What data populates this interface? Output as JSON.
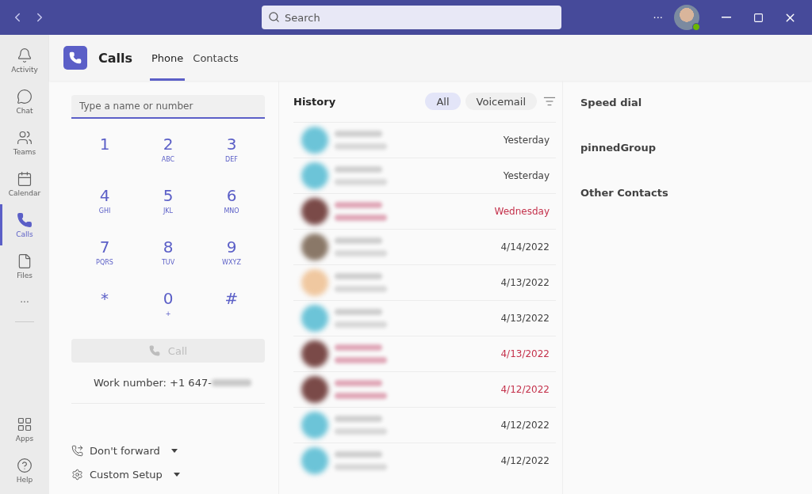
{
  "titlebar": {
    "search_placeholder": "Search",
    "more": "···"
  },
  "sidebar": {
    "items": [
      {
        "label": "Activity",
        "selected": false
      },
      {
        "label": "Chat",
        "selected": false
      },
      {
        "label": "Teams",
        "selected": false
      },
      {
        "label": "Calendar",
        "selected": false
      },
      {
        "label": "Calls",
        "selected": true
      },
      {
        "label": "Files",
        "selected": false
      }
    ],
    "more": "···",
    "bottom": [
      {
        "label": "Apps",
        "selected": false
      },
      {
        "label": "Help",
        "selected": false
      }
    ]
  },
  "header": {
    "title": "Calls",
    "tabs": [
      {
        "label": "Phone",
        "selected": true
      },
      {
        "label": "Contacts",
        "selected": false
      }
    ]
  },
  "dialer": {
    "placeholder": "Type a name or number",
    "keys": [
      {
        "digit": "1"
      },
      {
        "digit": "2",
        "letters": "ABC"
      },
      {
        "digit": "3",
        "letters": "DEF"
      },
      {
        "digit": "4",
        "letters": "GHI"
      },
      {
        "digit": "5",
        "letters": "JKL"
      },
      {
        "digit": "6",
        "letters": "MNO"
      },
      {
        "digit": "7",
        "letters": "PQRS"
      },
      {
        "digit": "8",
        "letters": "TUV"
      },
      {
        "digit": "9",
        "letters": "WXYZ"
      },
      {
        "digit": "*"
      },
      {
        "digit": "0",
        "letters": "+"
      },
      {
        "digit": "#"
      }
    ],
    "call_button": {
      "label": "Call",
      "disabled": true
    },
    "work_number": "Work number: +1 647-",
    "options": [
      {
        "kind": "forward",
        "label": "Don't forward"
      },
      {
        "kind": "setup",
        "label": "Custom Setup"
      }
    ]
  },
  "history": {
    "title": "History",
    "filters": [
      {
        "label": "All",
        "selected": true
      },
      {
        "label": "Voicemail",
        "selected": false
      }
    ],
    "rows": [
      {
        "time": "Yesterday",
        "missed": false,
        "color": "#6cc4d8"
      },
      {
        "time": "Yesterday",
        "missed": false,
        "color": "#6cc4d8"
      },
      {
        "time": "Wednesday",
        "missed": true,
        "color": "#7a4a48"
      },
      {
        "time": "4/14/2022",
        "missed": false,
        "color": "#8a7868"
      },
      {
        "time": "4/13/2022",
        "missed": false,
        "color": "#f0c8a0"
      },
      {
        "time": "4/13/2022",
        "missed": false,
        "color": "#6cc4d8"
      },
      {
        "time": "4/13/2022",
        "missed": true,
        "color": "#7a4a48"
      },
      {
        "time": "4/12/2022",
        "missed": true,
        "color": "#7a4a48"
      },
      {
        "time": "4/12/2022",
        "missed": false,
        "color": "#6cc4d8"
      },
      {
        "time": "4/12/2022",
        "missed": false,
        "color": "#6cc4d8"
      }
    ]
  },
  "contacts": {
    "sections": [
      "Speed dial",
      "pinnedGroup",
      "Other Contacts"
    ]
  }
}
